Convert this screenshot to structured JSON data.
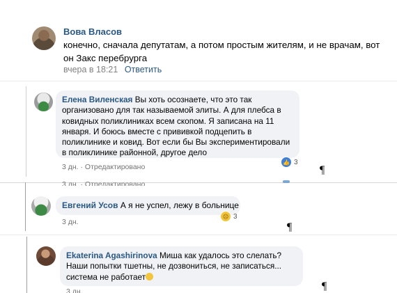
{
  "comment_top": {
    "author": "Вова Власов",
    "text": "конечно, сначала депутатам, а потом простым жителям, и не врачам, вот он Закс перебрурга",
    "time": "вчера в 18:21",
    "reply": "Ответить"
  },
  "replies": [
    {
      "author": "Елена Виленская",
      "text": "Вы хоть осознаете, что это так организовано для так называемой элиты. А для плебса в ковидных поликлиниках всем скопом. Я записана на 11 января. И боюсь вместе с прививкой подцепить в поликлинике и ковид. Вот если бы Вы экспериментировали в поликлинике районной, другое дело",
      "meta": "3 дн. · Отредактировано",
      "meta_ghost": "3 дн. · Отредактировано",
      "reaction_icon": "like-icon",
      "reaction_count": "3"
    },
    {
      "author": "Евгений Усов",
      "text": "А я не успел, лежу в больнице",
      "meta": "3 дн.",
      "reaction_icon": "sad-icon",
      "reaction_count": "3"
    },
    {
      "author": "Ekaterina Agashirinova",
      "text": "Миша как удалось это слелать? Наши попытки тшетны, не дозвониться, не записаться... система не работает",
      "meta": "3 дн."
    }
  ],
  "pilcrow": "¶",
  "colors": {
    "link": "#2a5885",
    "bubble": "#f0f2f5",
    "meta": "#828282"
  }
}
